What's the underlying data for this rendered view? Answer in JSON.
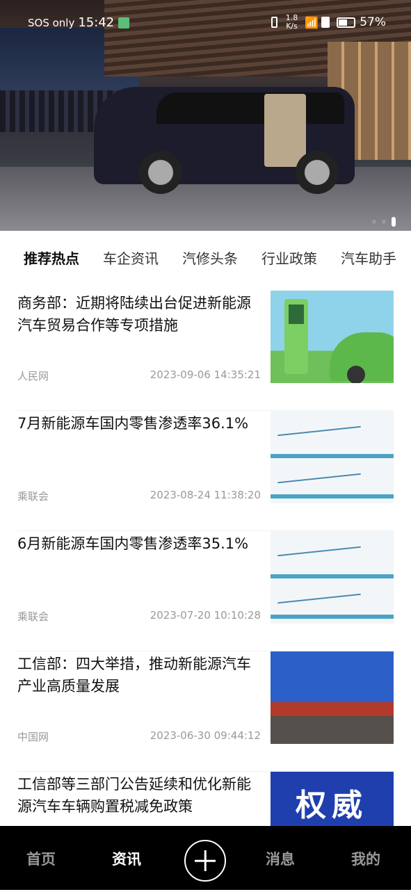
{
  "status_bar": {
    "carrier": "SOS only",
    "time": "15:42",
    "speed_top": "1.8",
    "speed_unit": "K/s",
    "battery": "57%"
  },
  "banner": {
    "slide_count": 3,
    "active_slide": 3
  },
  "tabs": [
    {
      "label": "推荐热点",
      "active": true
    },
    {
      "label": "车企资讯"
    },
    {
      "label": "汽修头条"
    },
    {
      "label": "行业政策"
    },
    {
      "label": "汽车助手"
    }
  ],
  "articles": [
    {
      "title": "商务部：近期将陆续出台促进新能源汽车贸易合作等专项措施",
      "source": "人民网",
      "time": "2023-09-06 14:35:21",
      "thumb": "ev-charging"
    },
    {
      "title": "7月新能源车国内零售渗透率36.1%",
      "source": "乘联会",
      "time": "2023-08-24 11:38:20",
      "thumb": "chart"
    },
    {
      "title": "6月新能源车国内零售渗透率35.1%",
      "source": "乘联会",
      "time": "2023-07-20 10:10:28",
      "thumb": "chart"
    },
    {
      "title": "工信部：四大举措，推动新能源汽车产业高质量发展",
      "source": "中国网",
      "time": "2023-06-30 09:44:12",
      "thumb": "press-conference"
    },
    {
      "title": "工信部等三部门公告延续和优化新能源汽车车辆购置税减免政策",
      "source": "",
      "time": "",
      "thumb": "authority-banner"
    }
  ],
  "bottom_nav": [
    {
      "label": "首页"
    },
    {
      "label": "资讯",
      "active": true
    },
    {
      "icon": "plus-circle-icon"
    },
    {
      "label": "消息"
    },
    {
      "label": "我的"
    }
  ],
  "thumb_texts": {
    "authority": "权威"
  }
}
